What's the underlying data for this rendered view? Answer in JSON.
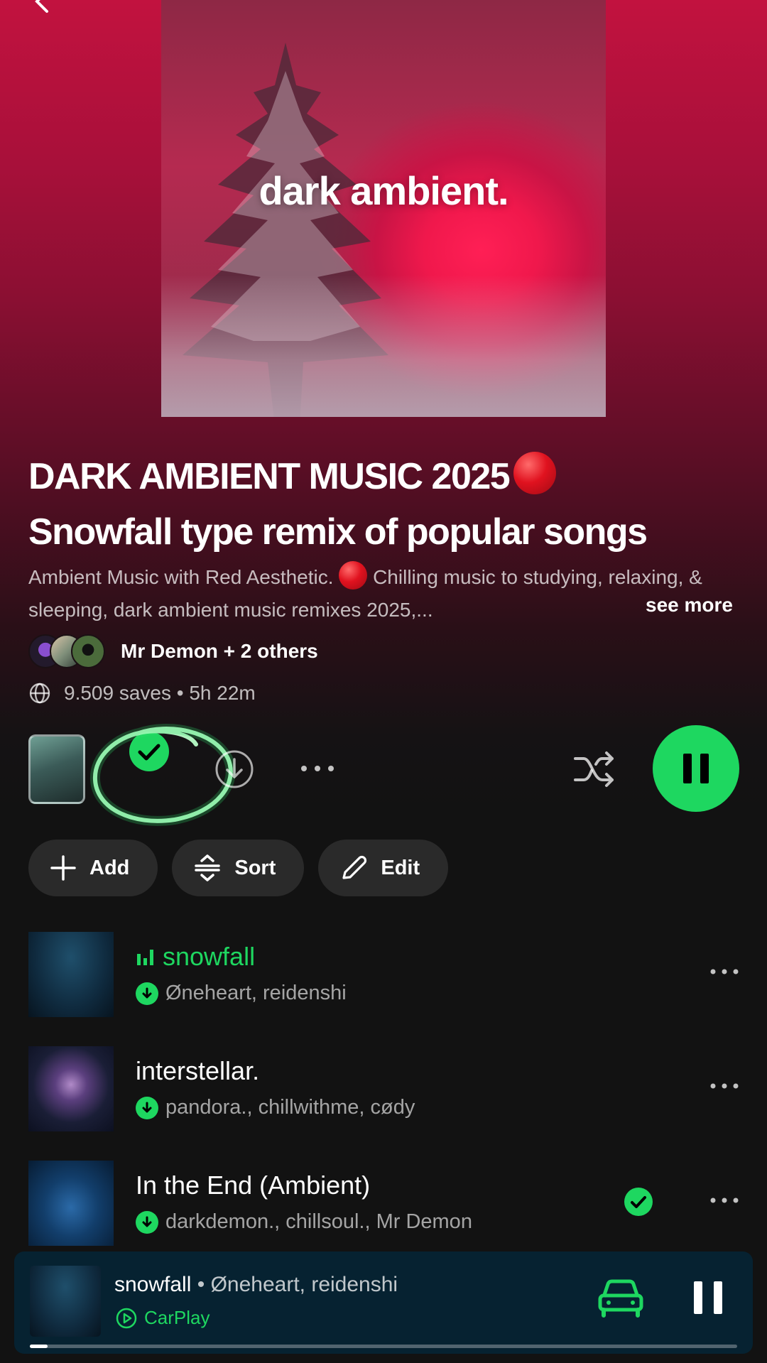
{
  "cover": {
    "text": "dark ambient."
  },
  "playlist": {
    "title_line1": "DARK AMBIENT MUSIC 2025",
    "title_line2": "Snowfall type remix of popular songs",
    "description_part1": "Ambient Music with Red Aesthetic.",
    "description_part2": "Chilling music to studying, relaxing, & sleeping, dark ambient music remixes 2025,...",
    "see_more": "see more",
    "owners": "Mr Demon + 2 others",
    "meta": "9.509 saves • 5h 22m"
  },
  "actions": {
    "add": "Add",
    "sort": "Sort",
    "edit": "Edit"
  },
  "tracks": [
    {
      "title": "snowfall",
      "artists": "Øneheart, reidenshi",
      "playing": true,
      "saved": false
    },
    {
      "title": "interstellar.",
      "artists": "pandora., chillwithme, cødy",
      "playing": false,
      "saved": false
    },
    {
      "title": "In the End (Ambient)",
      "artists": "darkdemon., chillsoul., Mr Demon",
      "playing": false,
      "saved": true
    }
  ],
  "now_playing": {
    "title": "snowfall",
    "separator": " • ",
    "artist": "Øneheart, reidenshi",
    "device": "CarPlay",
    "progress": 0.025
  },
  "colors": {
    "accent": "#1ed760",
    "background": "#121212",
    "header_red": "#c2123f"
  },
  "icons": [
    "back-icon",
    "globe-icon",
    "check-icon",
    "download-icon",
    "more-icon",
    "shuffle-icon",
    "pause-icon",
    "plus-icon",
    "sort-icon",
    "pencil-icon",
    "equalizer-icon",
    "car-icon",
    "carplay-icon"
  ]
}
